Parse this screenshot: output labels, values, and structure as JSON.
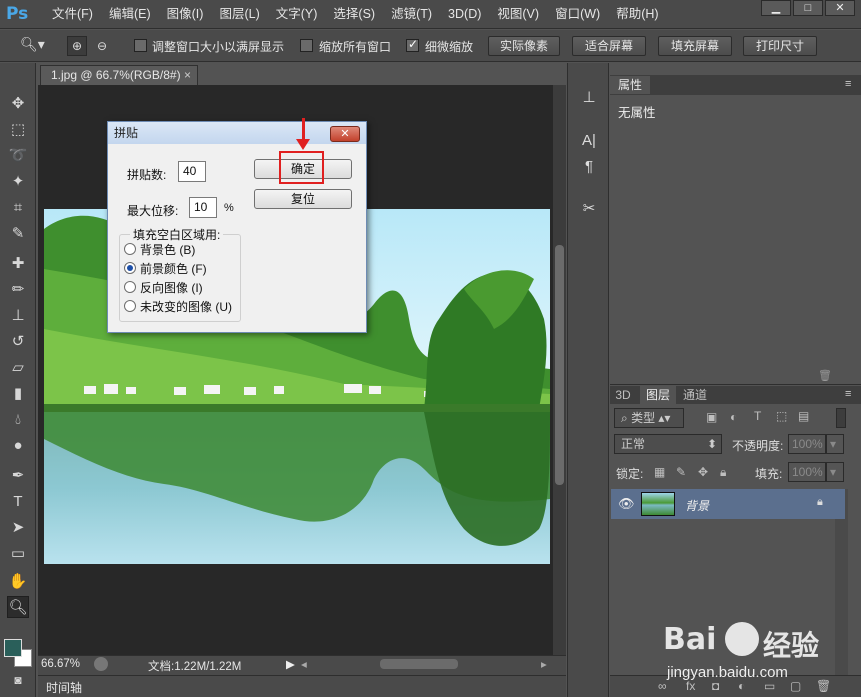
{
  "app": {
    "logo": "Ps"
  },
  "menu": [
    "文件(F)",
    "编辑(E)",
    "图像(I)",
    "图层(L)",
    "文字(Y)",
    "选择(S)",
    "滤镜(T)",
    "3D(D)",
    "视图(V)",
    "窗口(W)",
    "帮助(H)"
  ],
  "window_controls": {
    "minimize": "▁",
    "maximize": "□",
    "close": "✕"
  },
  "options": {
    "resize_windows": "调整窗口大小以满屏显示",
    "zoom_all": "缩放所有窗口",
    "scrubby_zoom": "细微缩放",
    "scrubby_checked": true,
    "actual_pixels": "实际像素",
    "fit_screen": "适合屏幕",
    "fill_screen": "填充屏幕",
    "print_size": "打印尺寸"
  },
  "document": {
    "tab_title": "1.jpg @ 66.7%(RGB/8#)",
    "tab_close": "×",
    "zoom": "66.67%",
    "doc_info": "文档:1.22M/1.22M",
    "timeline": "时间轴"
  },
  "properties_panel": {
    "tab": "属性",
    "content": "无属性"
  },
  "layers_panel": {
    "tabs": [
      "3D",
      "图层",
      "通道"
    ],
    "filter_label": "类型",
    "blend_mode": "正常",
    "opacity_label": "不透明度:",
    "opacity_value": "100%",
    "lock_label": "锁定:",
    "fill_label": "填充:",
    "fill_value": "100%",
    "layer_name": "背景"
  },
  "dialog": {
    "title": "拼贴",
    "close": "✕",
    "tiles_label": "拼贴数:",
    "tiles_value": "40",
    "max_offset_label": "最大位移:",
    "max_offset_value": "10",
    "percent": "%",
    "ok": "确定",
    "reset": "复位",
    "fill_group_label": "填充空白区域用:",
    "fill_options": [
      "背景色 (B)",
      "前景颜色 (F)",
      "反向图像 (I)",
      "未改变的图像 (U)"
    ],
    "selected_fill_index": 1
  },
  "watermark": {
    "brand": "Bai",
    "brand_suffix": "经验",
    "url": "jingyan.baidu.com"
  },
  "colors": {
    "accent_red": "#e02020",
    "ps_blue": "#4aa8e8",
    "selected_layer": "#5b6f8e"
  }
}
